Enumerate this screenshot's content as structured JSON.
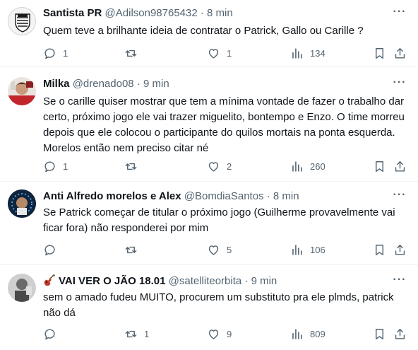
{
  "tweets": [
    {
      "name": "Santista PR",
      "handle": "@Adilson98765432",
      "time": "8 min",
      "text": "Quem teve a brilhante ideia de contratar o Patrick, Gallo ou Carille  ?",
      "replies": "1",
      "retweets": "",
      "likes": "1",
      "views": "134"
    },
    {
      "name": "Milka",
      "handle": "@drenado08",
      "time": "9 min",
      "text": "Se o carille quiser mostrar que tem a mínima vontade de fazer o trabalho dar certo, próximo jogo ele vai trazer miguelito, bontempo e Enzo. O time morreu depois que ele colocou o participante do quilos mortais na ponta esquerda. Morelos então nem preciso citar né",
      "replies": "1",
      "retweets": "",
      "likes": "2",
      "views": "260"
    },
    {
      "name": "Anti Alfredo morelos e Alex",
      "handle": "@BomdiaSantos",
      "time": "8 min",
      "text": "Se Patrick começar de titular o próximo jogo (Guilherme provavelmente vai ficar fora) não responderei por mim",
      "replies": "",
      "retweets": "",
      "likes": "5",
      "views": "106"
    },
    {
      "name": "VAI VER O JÃO 18.01",
      "name_emoji": "guitar-emoji",
      "handle": "@satelliteorbita",
      "time": "9 min",
      "text": "sem o amado fudeu MUITO, procurem um substituto pra ele plmds, patrick não dá",
      "replies": "",
      "retweets": "1",
      "likes": "9",
      "views": "809"
    }
  ],
  "separator": "·",
  "more_icon": "more-horizontal-icon",
  "icons": [
    "reply-icon",
    "retweet-icon",
    "like-icon",
    "views-icon",
    "bookmark-icon",
    "share-icon"
  ]
}
